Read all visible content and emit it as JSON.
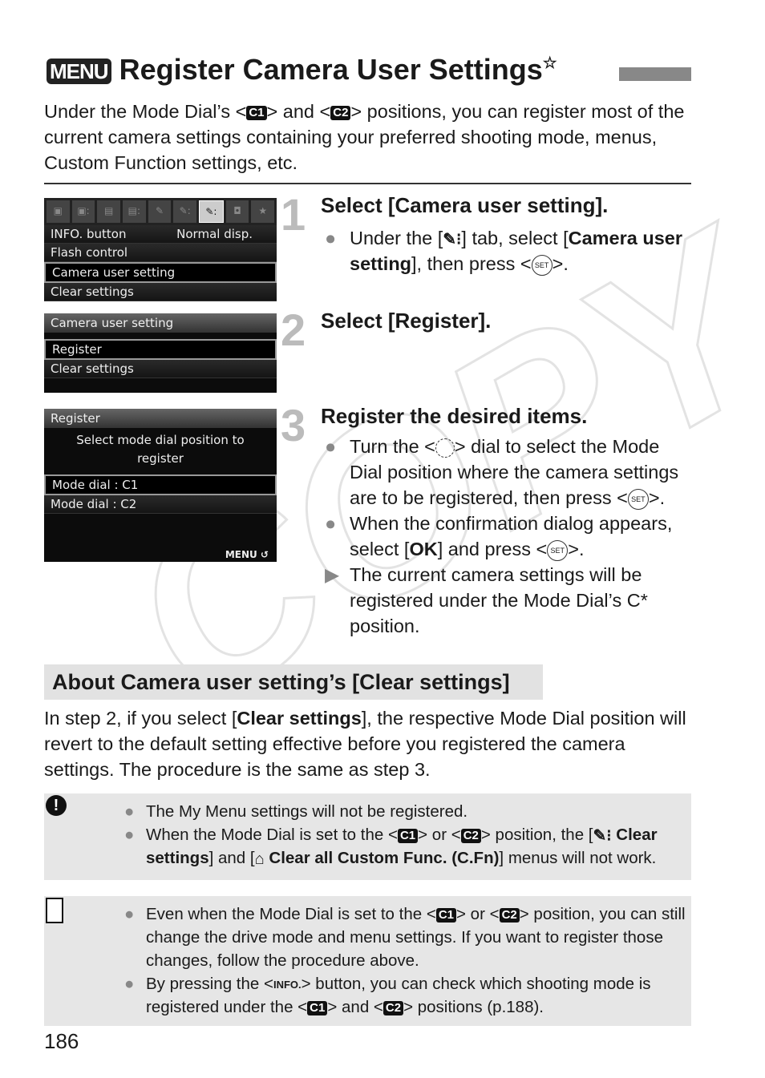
{
  "header": {
    "menu_badge": "MENU",
    "title": "Register Camera User Settings",
    "star": "☆"
  },
  "intro": [
    {
      "t": "Under the Mode Dial’s <"
    },
    {
      "icon": "C1"
    },
    {
      "t": "> and <"
    },
    {
      "icon": "C2"
    },
    {
      "t": "> positions, you can register most of the current camera settings containing your preferred shooting mode, menus, Custom Function settings, etc."
    }
  ],
  "screens": {
    "s1": {
      "tabs": [
        "▣",
        "▣:",
        "▤",
        "▤:",
        "✎",
        "✎:",
        "✎:",
        "◘",
        "★"
      ],
      "rows": [
        [
          "INFO. button",
          "Normal disp."
        ],
        [
          "Flash control",
          ""
        ],
        [
          "Camera user setting",
          ""
        ],
        [
          "Clear settings",
          ""
        ]
      ]
    },
    "s2": {
      "header": "Camera user setting",
      "rows": [
        "Register",
        "Clear settings"
      ]
    },
    "s3": {
      "header": "Register",
      "prompt": "Select mode dial position to register",
      "rows": [
        "Mode dial : C1",
        "Mode dial : C2"
      ],
      "footer": "MENU ↺"
    }
  },
  "steps": [
    {
      "num": "1",
      "title": "Select [Camera user setting].",
      "bullets": [
        {
          "mark": "●",
          "text": [
            {
              "t": "Under the ["
            },
            {
              "icon": "tool"
            },
            {
              "t": "] tab, select ["
            },
            {
              "t": "Camera user setting",
              "b": true
            },
            {
              "t": "], then press <"
            },
            {
              "icon": "SET"
            },
            {
              "t": ">."
            }
          ]
        }
      ]
    },
    {
      "num": "2",
      "title": "Select [Register].",
      "bullets": []
    },
    {
      "num": "3",
      "title": "Register the desired items.",
      "bullets": [
        {
          "mark": "●",
          "text": [
            {
              "t": "Turn the <"
            },
            {
              "icon": "dial"
            },
            {
              "t": "> dial to select the Mode Dial position where the camera settings are to be registered, then press <"
            },
            {
              "icon": "SET"
            },
            {
              "t": ">."
            }
          ]
        },
        {
          "mark": "●",
          "text": [
            {
              "t": "When the confirmation dialog appears, select ["
            },
            {
              "t": "OK",
              "b": true
            },
            {
              "t": "] and press <"
            },
            {
              "icon": "SET"
            },
            {
              "t": ">."
            }
          ]
        },
        {
          "mark": "▶",
          "text": [
            {
              "t": "The current camera settings will be registered under the Mode Dial’s C* position."
            }
          ]
        }
      ]
    }
  ],
  "section": {
    "heading": "About Camera user setting’s [Clear settings]",
    "para": [
      {
        "t": "In step 2, if you select ["
      },
      {
        "t": "Clear settings",
        "b": true
      },
      {
        "t": "], the respective Mode Dial position will revert to the default setting effective before you registered the camera settings. The procedure is the same as step 3."
      }
    ]
  },
  "caution": {
    "icon": "caution-icon",
    "items": [
      [
        {
          "t": "The My Menu settings will not be registered."
        }
      ],
      [
        {
          "t": "When the Mode Dial is set to the <"
        },
        {
          "icon": "C1"
        },
        {
          "t": "> or <"
        },
        {
          "icon": "C2"
        },
        {
          "t": "> position, the ["
        },
        {
          "icon": "tool"
        },
        {
          "t": " Clear settings",
          "b": true
        },
        {
          "t": "] and ["
        },
        {
          "icon": "cfn"
        },
        {
          "t": " Clear all Custom Func. (C.Fn)",
          "b": true
        },
        {
          "t": "] menus will not work."
        }
      ]
    ]
  },
  "note": {
    "icon": "note-icon",
    "items": [
      [
        {
          "t": "Even when the Mode Dial is set to the <"
        },
        {
          "icon": "C1"
        },
        {
          "t": "> or <"
        },
        {
          "icon": "C2"
        },
        {
          "t": "> position, you can still change the drive mode and menu settings. If you want to register those changes, follow the procedure above."
        }
      ],
      [
        {
          "t": "By pressing the <"
        },
        {
          "icon": "INFO."
        },
        {
          "t": "> button, you can check which shooting mode is registered under the <"
        },
        {
          "icon": "C1"
        },
        {
          "t": "> and <"
        },
        {
          "icon": "C2"
        },
        {
          "t": "> positions (p.188)."
        }
      ]
    ]
  },
  "watermark": "COPY",
  "page_number": "186"
}
